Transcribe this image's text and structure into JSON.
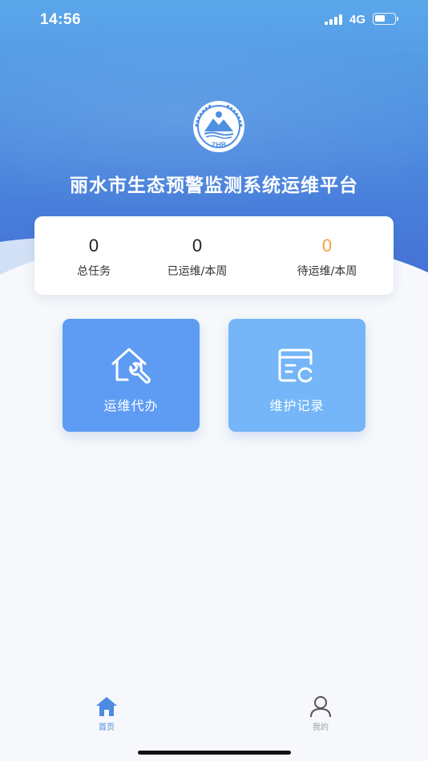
{
  "status_bar": {
    "time": "14:56",
    "network": "4G"
  },
  "header": {
    "title": "丽水市生态预警监测系统运维平台",
    "logo_text": "ZHB"
  },
  "stats": [
    {
      "value": "0",
      "label": "总任务"
    },
    {
      "value": "0",
      "label": "已运维/本周"
    },
    {
      "value": "0",
      "label": "待运维/本周"
    }
  ],
  "actions": [
    {
      "label": "运维代办",
      "icon": "house-wrench-icon"
    },
    {
      "label": "维护记录",
      "icon": "record-card-icon"
    }
  ],
  "tabbar": [
    {
      "label": "首页",
      "icon": "home-icon",
      "active": true
    },
    {
      "label": "我的",
      "icon": "user-icon",
      "active": false
    }
  ],
  "colors": {
    "primary": "#5e9cf3",
    "secondary": "#74b6f7",
    "accent_pending": "#f0a23a",
    "tab_active": "#4d8be3",
    "tab_inactive": "#9aa0a8"
  }
}
